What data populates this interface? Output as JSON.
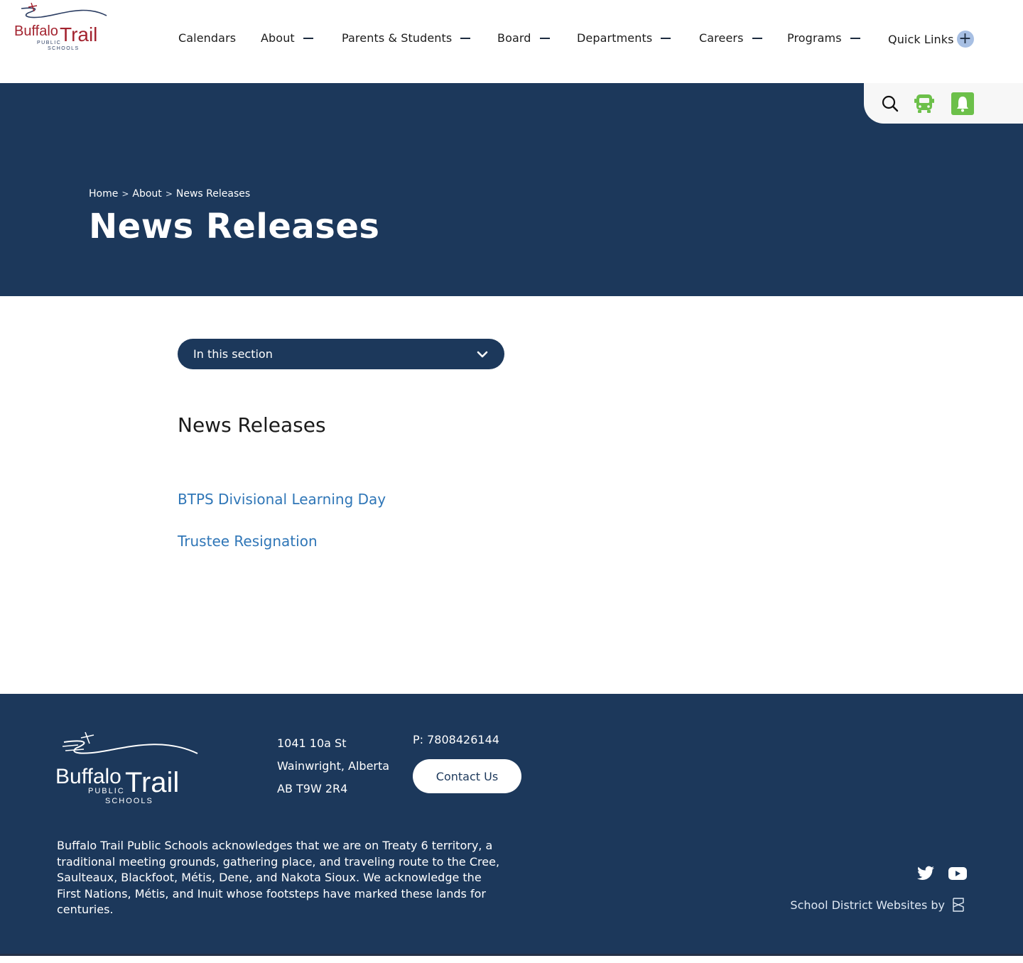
{
  "header": {
    "logo": {
      "line1": "Buffalo",
      "line2": "Trail",
      "line3": "PUBLIC",
      "line4": "SCHOOLS"
    },
    "nav": [
      {
        "label": "Calendars",
        "has_submenu": false
      },
      {
        "label": "About",
        "has_submenu": true
      },
      {
        "label": "Parents & Students",
        "has_submenu": true
      },
      {
        "label": "Board",
        "has_submenu": true
      },
      {
        "label": "Departments",
        "has_submenu": true
      },
      {
        "label": "Careers",
        "has_submenu": true
      },
      {
        "label": "Programs",
        "has_submenu": true
      },
      {
        "label": "Quick Links",
        "has_submenu": true,
        "icon": "plus-icon"
      }
    ],
    "utility_icons": [
      "search-icon",
      "bus-icon",
      "bell-icon"
    ]
  },
  "hero": {
    "breadcrumb": [
      {
        "label": "Home"
      },
      {
        "label": "About"
      },
      {
        "label": "News Releases"
      }
    ],
    "breadcrumb_separator": ">",
    "title": "News Releases"
  },
  "main": {
    "section_dropdown_label": "In this section",
    "content_title": "News Releases",
    "news_items": [
      {
        "title": "BTPS Divisional Learning Day"
      },
      {
        "title": "Trustee Resignation"
      }
    ]
  },
  "footer": {
    "logo": {
      "line1": "Buffalo",
      "line2": "Trail",
      "line3": "PUBLIC",
      "line4": "SCHOOLS"
    },
    "address": {
      "line1": "1041 10a St",
      "line2": "Wainwright, Alberta",
      "line3": "AB T9W 2R4"
    },
    "phone": "P: 7808426144",
    "contact_button": "Contact Us",
    "acknowledgement": "Buffalo Trail Public Schools acknowledges that we are on Treaty 6 territory, a traditional meeting grounds, gathering place, and traveling route to the Cree, Saulteaux, Blackfoot, Métis, Dene, and Nakota Sioux. We acknowledge the First Nations, Métis, and Inuit whose footsteps have marked these lands for centuries.",
    "social": [
      "twitter-icon",
      "youtube-icon"
    ],
    "credit": "School District Websites by"
  },
  "colors": {
    "navy": "#1c385b",
    "link_blue": "#2f76b7",
    "accent_green": "#6cc04a",
    "logo_red": "#a3232f",
    "quick_links_plus_bg": "#a7bfe3"
  }
}
